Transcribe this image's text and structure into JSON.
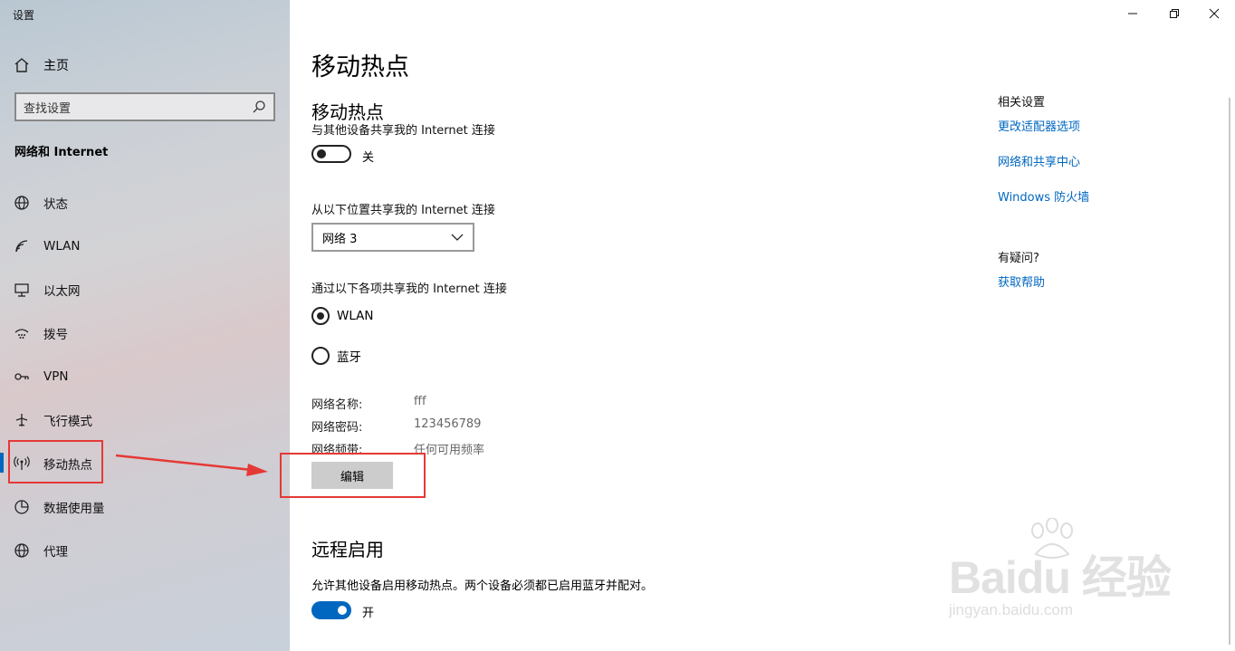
{
  "window": {
    "title": "设置"
  },
  "sidebar": {
    "home_label": "主页",
    "search_placeholder": "查找设置",
    "section_title": "网络和 Internet",
    "items": [
      {
        "label": "状态",
        "icon": "globe-icon"
      },
      {
        "label": "WLAN",
        "icon": "wifi-icon"
      },
      {
        "label": "以太网",
        "icon": "ethernet-icon"
      },
      {
        "label": "拨号",
        "icon": "dialup-icon"
      },
      {
        "label": "VPN",
        "icon": "vpn-icon"
      },
      {
        "label": "飞行模式",
        "icon": "airplane-icon"
      },
      {
        "label": "移动热点",
        "icon": "hotspot-icon",
        "selected": true
      },
      {
        "label": "数据使用量",
        "icon": "data-usage-icon"
      },
      {
        "label": "代理",
        "icon": "globe-icon"
      }
    ]
  },
  "main": {
    "page_title": "移动热点",
    "hotspot": {
      "heading": "移动热点",
      "share_label": "与其他设备共享我的 Internet 连接",
      "toggle_state": "关",
      "share_from_label": "从以下位置共享我的 Internet 连接",
      "share_from_value": "网络 3",
      "share_over_label": "通过以下各项共享我的 Internet 连接",
      "options": [
        {
          "label": "WLAN",
          "checked": true
        },
        {
          "label": "蓝牙",
          "checked": false
        }
      ],
      "network_name_key": "网络名称:",
      "network_name_value": "fff",
      "network_password_key": "网络密码:",
      "network_password_value": "123456789",
      "network_band_key": "网络频带:",
      "network_band_value": "任何可用频率",
      "edit_label": "编辑"
    },
    "remote": {
      "heading": "远程启用",
      "description": "允许其他设备启用移动热点。两个设备必须都已启用蓝牙并配对。",
      "toggle_state": "开"
    }
  },
  "related": {
    "heading": "相关设置",
    "links": [
      "更改适配器选项",
      "网络和共享中心",
      "Windows 防火墙"
    ],
    "question_heading": "有疑问?",
    "help_link": "获取帮助"
  },
  "watermark": {
    "logo": "Baidu 经验",
    "url": "jingyan.baidu.com"
  },
  "colors": {
    "accent": "#0067c0",
    "annotation": "#e53935"
  }
}
